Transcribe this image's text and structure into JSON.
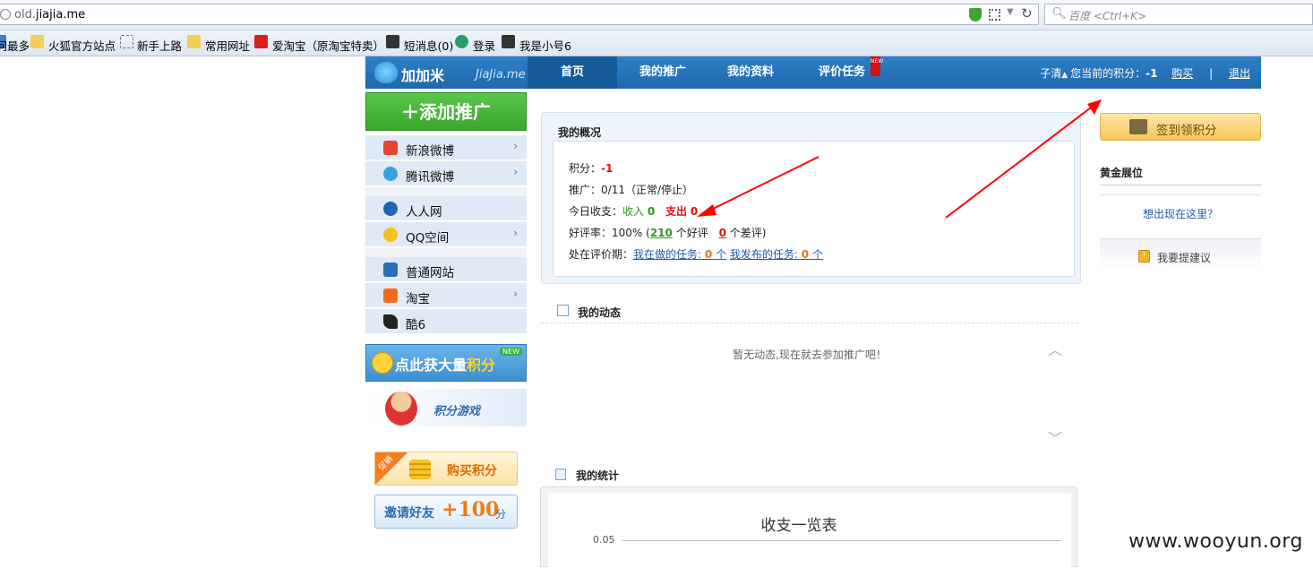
{
  "browser": {
    "url_prefix": "old.",
    "url_host": "jiajia.me",
    "search_placeholder": "百度 <Ctrl+K>"
  },
  "bookmarks": [
    "访问最多",
    "火狐官方站点",
    "新手上路",
    "常用网址",
    "爱淘宝（原淘宝特卖）",
    "短消息(0)",
    "登录",
    "我是小号6"
  ],
  "header": {
    "logo_text": "加加米",
    "logo_sub": "JiaJia.me",
    "nav": [
      "首页",
      "我的推广",
      "我的资料",
      "评价任务"
    ],
    "nav_badge": "NEW",
    "user_name": "子清",
    "points_label": "您当前的积分：",
    "points_value": "-1",
    "buy_link": "购买",
    "logout_link": "退出"
  },
  "sidebar": {
    "add_button": "添加推广",
    "items": [
      "新浪微博",
      "腾讯微博",
      "人人网",
      "QQ空间",
      "普通网站",
      "淘宝",
      "酷6"
    ],
    "earn_banner_prefix": "点此获大量",
    "earn_banner_highlight": "积分",
    "earn_banner_badge": "NEW",
    "game_banner": "积分游戏",
    "buy_tag": "促销",
    "buy_label": "购买积分",
    "invite_label": "邀请好友",
    "invite_amount": "+100",
    "invite_unit": "分"
  },
  "overview": {
    "title": "我的概况",
    "points_label": "积分：",
    "points_value": "-1",
    "promo_label": "推广：",
    "promo_value": "0/11（正常/停止）",
    "today_label": "今日收支：",
    "income_label": "收入",
    "income_value": "0",
    "expense_label": "支出",
    "expense_value": "0",
    "rating_label": "好评率：",
    "rating_value": "100% (",
    "good_count": "210",
    "good_label": "个好评",
    "bad_count": "0",
    "bad_label": "个差评)",
    "review_label": "处在评价期：",
    "doing_tasks_label": "我在做的任务:",
    "doing_tasks_count": "0",
    "doing_tasks_unit": "个",
    "published_tasks_label": "我发布的任务:",
    "published_tasks_count": "0",
    "published_tasks_unit": "个"
  },
  "activity": {
    "title": "我的动态",
    "empty_text": "暂无动态,现在就去参加推广吧！"
  },
  "stats": {
    "title": "我的统计",
    "chart_title": "收支一览表",
    "y_tick": "0.05"
  },
  "right": {
    "checkin_button": "签到领积分",
    "golden_title": "黄金展位",
    "golden_link": "想出现在这里？",
    "suggest_label": "我要提建议"
  },
  "watermark": "www.wooyun.org",
  "colors": {
    "header_blue": "#2673bb",
    "add_green": "#46b236",
    "highlight_red": "#d81313",
    "annotation_red": "#ff0000"
  }
}
